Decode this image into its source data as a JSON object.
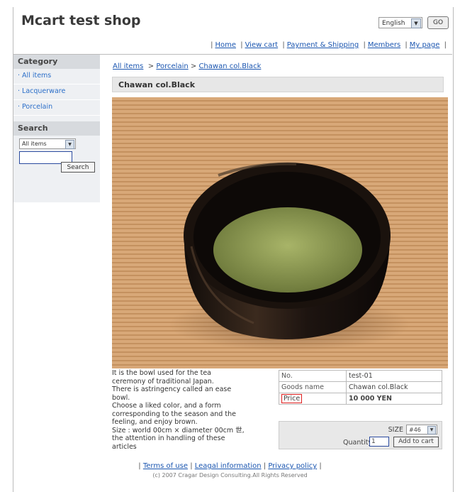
{
  "header": {
    "shop_title": "Mcart test shop",
    "language": "English",
    "go_label": "GO"
  },
  "nav": [
    {
      "label": "Home"
    },
    {
      "label": "View cart"
    },
    {
      "label": "Payment & Shipping"
    },
    {
      "label": "Members"
    },
    {
      "label": "My page"
    }
  ],
  "sidebar": {
    "category_heading": "Category",
    "categories": [
      {
        "label": "All items"
      },
      {
        "label": "Lacquerware"
      },
      {
        "label": "Porcelain"
      }
    ],
    "search_heading": "Search",
    "search_scope": "All items",
    "search_value": "",
    "search_button": "Search"
  },
  "breadcrumb": {
    "items": [
      {
        "label": "All items"
      },
      {
        "label": "Porcelain"
      },
      {
        "label": "Chawan col.Black"
      }
    ],
    "sep": ">"
  },
  "product": {
    "title": "Chawan col.Black",
    "description": [
      "It is the bowl used for the tea",
      "ceremony of traditional Japan.",
      "There is astringency called an ease",
      "bowl.",
      "Choose a liked color, and a form",
      "corresponding to the season and the",
      "feeling, and enjoy brown.",
      "Size : world 00cm × diameter 00cm 世,",
      "the attention in handling of these",
      "articles"
    ],
    "info": {
      "no_label": "No.",
      "no_value": "test-01",
      "name_label": "Goods name",
      "name_value": "Chawan col.Black",
      "price_label": "Price",
      "price_value": "10 000 YEN"
    },
    "cart": {
      "size_label": "SIZE",
      "size_value": "#46",
      "quantity_label": "Quantity:",
      "quantity_value": "1",
      "add_label": "Add to cart"
    }
  },
  "footer": {
    "links": [
      {
        "label": "Terms of use"
      },
      {
        "label": "Leagal information"
      },
      {
        "label": "Privacy policy"
      }
    ],
    "copyright": "(c) 2007 Cragar Design Consulting.All Rights Reserved"
  },
  "colors": {
    "link": "#1b56b0",
    "price_highlight": "#e02020",
    "sidebar_bg": "#eef0f3"
  }
}
